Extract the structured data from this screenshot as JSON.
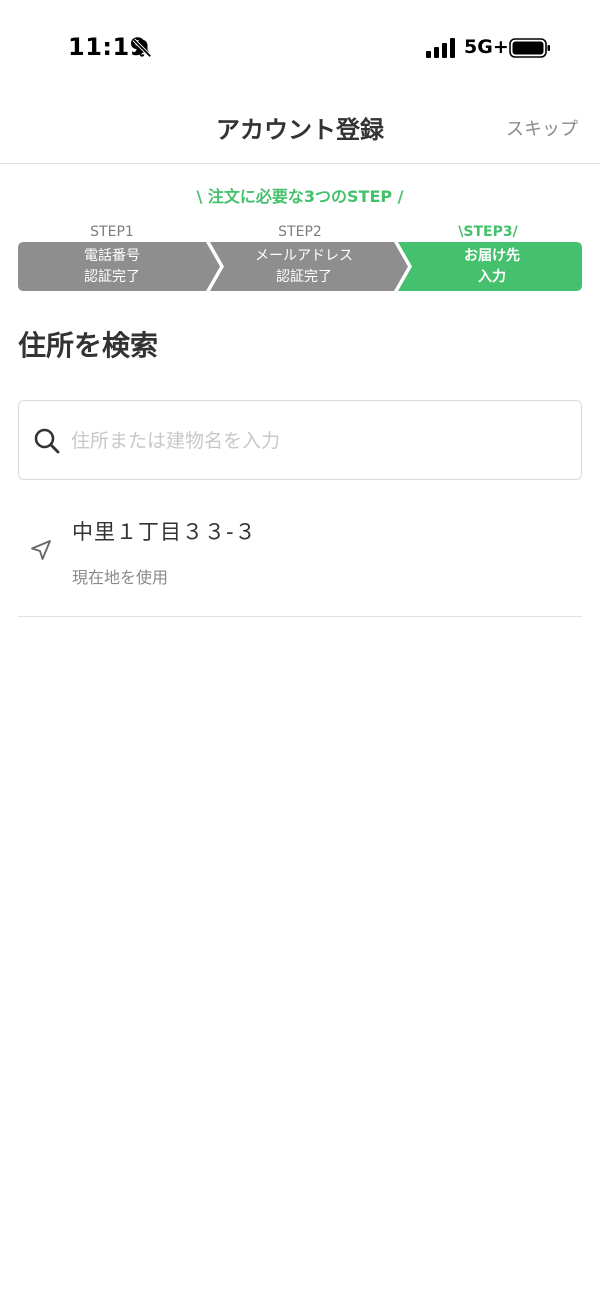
{
  "status_bar": {
    "time": "11:19",
    "network": "5G+",
    "icons": [
      "bell-slash-icon",
      "signal-icon",
      "battery-icon"
    ]
  },
  "header": {
    "title": "アカウント登録",
    "skip_label": "スキップ"
  },
  "steps": {
    "caption": "\\ 注文に必要な3つのSTEP /",
    "items": [
      {
        "label": "STEP1",
        "text_line1": "電話番号",
        "text_line2": "認証完了",
        "state": "done"
      },
      {
        "label": "STEP2",
        "text_line1": "メールアドレス",
        "text_line2": "認証完了",
        "state": "done"
      },
      {
        "label": "\\STEP3/",
        "text_line1": "お届け先",
        "text_line2": "入力",
        "state": "current"
      }
    ]
  },
  "main": {
    "section_title": "住所を検索",
    "search": {
      "placeholder": "住所または建物名を入力",
      "value": ""
    },
    "location_item": {
      "address": "中里１丁目３３-３",
      "subtitle": "現在地を使用",
      "icon": "location-arrow-icon"
    }
  },
  "colors": {
    "accent_green": "#45c06c",
    "step_done_gray": "#8e8e8e",
    "text_primary": "#333333",
    "text_secondary": "#8a8a8a",
    "divider": "#e2e2e2"
  }
}
